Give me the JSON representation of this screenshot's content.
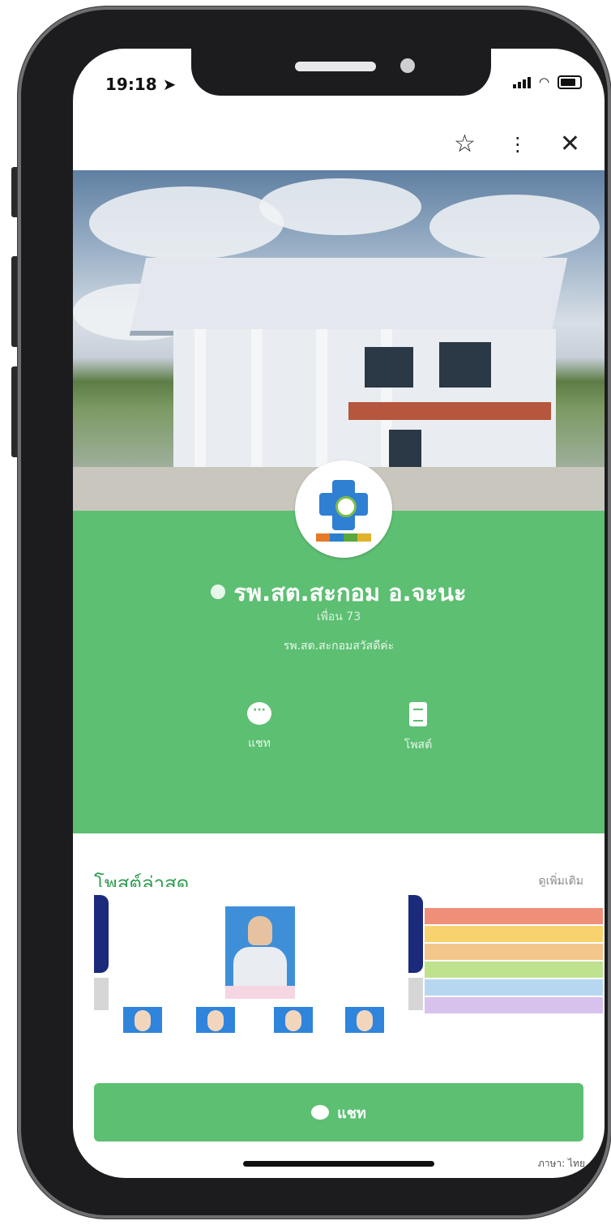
{
  "status_bar": {
    "time": "19:18"
  },
  "profile": {
    "name": "รพ.สต.สะกอม อ.จะนะ",
    "followers": "เพื่อน 73",
    "description": "รพ.สต.สะกอมสวัสดีค่ะ"
  },
  "actions": {
    "chat": "แชท",
    "posts": "โพสต์"
  },
  "latest_posts": {
    "title": "โพสต์ล่าสุด",
    "see_more": "ดูเพิ่มเติม"
  },
  "cta": {
    "label": "แชท"
  },
  "footer": {
    "language": "ภาษา: ไทย"
  },
  "colors": {
    "brand_green": "#5cbf72",
    "title_green": "#2e9d4f"
  }
}
